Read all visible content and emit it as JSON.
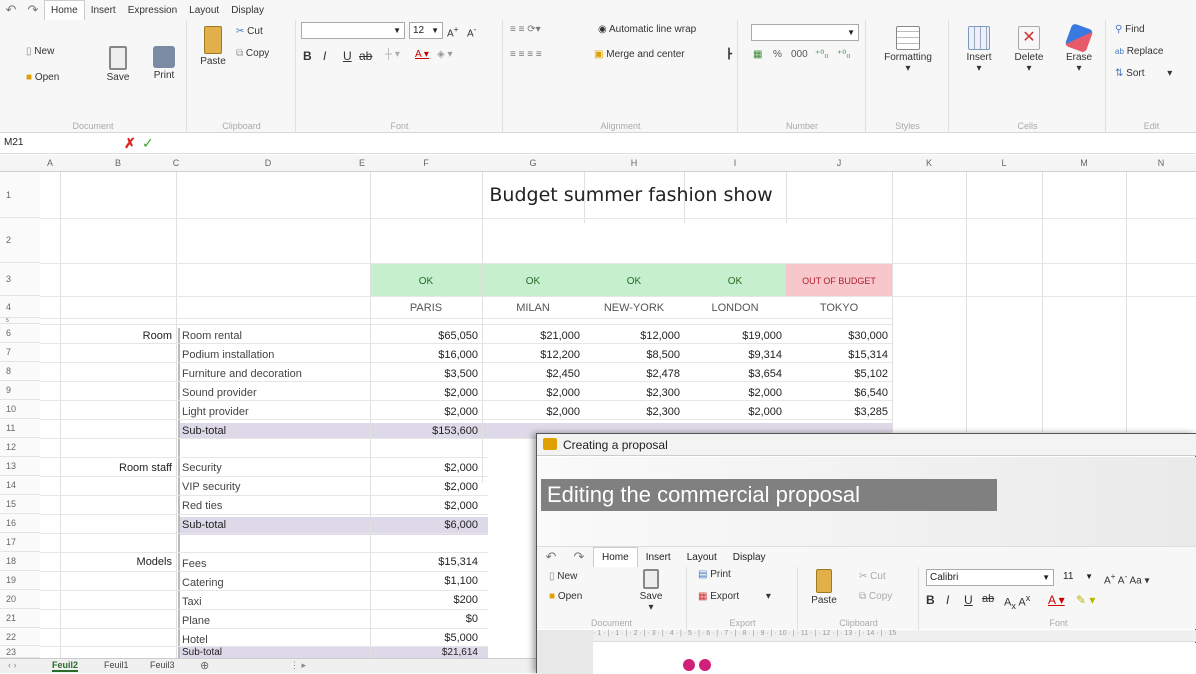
{
  "menu": {
    "tabs": [
      "Home",
      "Insert",
      "Expression",
      "Layout",
      "Display"
    ]
  },
  "ribbon": {
    "new": "New",
    "open": "Open",
    "save": "Save",
    "print": "Print",
    "paste": "Paste",
    "cut": "Cut",
    "copy": "Copy",
    "font_size": "12",
    "auto_wrap": "Automatic line wrap",
    "merge": "Merge and center",
    "num_fmt": "000",
    "formatting": "Formatting",
    "insert": "Insert",
    "delete": "Delete",
    "erase": "Erase",
    "find": "Find",
    "replace": "Replace",
    "sort": "Sort",
    "groups": [
      "Document",
      "Clipboard",
      "Font",
      "Alignment",
      "Number",
      "Styles",
      "Cells",
      "Edit"
    ]
  },
  "formula_bar": {
    "cell_ref": "M21"
  },
  "columns": [
    "A",
    "B",
    "C",
    "D",
    "E",
    "F",
    "G",
    "H",
    "I",
    "J",
    "K",
    "L",
    "M",
    "N"
  ],
  "rows": [
    "1",
    "2",
    "3",
    "4",
    "5",
    "6",
    "7",
    "8",
    "9",
    "10",
    "11",
    "12",
    "13",
    "14",
    "15",
    "16",
    "17",
    "18",
    "19",
    "20",
    "21",
    "22",
    "23"
  ],
  "sheet": {
    "title": "Budget summer fashion show",
    "status": [
      "OK",
      "OK",
      "OK",
      "OK",
      "OUT OF BUDGET"
    ],
    "cities": [
      "PARIS",
      "MILAN",
      "NEW-YORK",
      "LONDON",
      "TOKYO"
    ],
    "room_label": "Room",
    "room_items": [
      {
        "name": "Room rental",
        "v": [
          "$65,050",
          "$21,000",
          "$12,000",
          "$19,000",
          "$30,000"
        ]
      },
      {
        "name": "Podium installation",
        "v": [
          "$16,000",
          "$12,200",
          "$8,500",
          "$9,314",
          "$15,314"
        ]
      },
      {
        "name": "Furniture and decoration",
        "v": [
          "$3,500",
          "$2,450",
          "$2,478",
          "$3,654",
          "$5,102"
        ]
      },
      {
        "name": "Sound provider",
        "v": [
          "$2,000",
          "$2,000",
          "$2,300",
          "$2,000",
          "$6,540"
        ]
      },
      {
        "name": "Light provider",
        "v": [
          "$2,000",
          "$2,000",
          "$2,300",
          "$2,000",
          "$3,285"
        ]
      }
    ],
    "room_subtotal": {
      "name": "Sub-total",
      "v": "$153,600"
    },
    "staff_label": "Room staff",
    "staff_items": [
      {
        "name": "Security",
        "v": "$2,000"
      },
      {
        "name": "VIP security",
        "v": "$2,000"
      },
      {
        "name": "Red ties",
        "v": "$2,000"
      }
    ],
    "staff_subtotal": {
      "name": "Sub-total",
      "v": "$6,000"
    },
    "models_label": "Models",
    "models_items": [
      {
        "name": "Fees",
        "v": "$15,314"
      },
      {
        "name": "Catering",
        "v": "$1,100"
      },
      {
        "name": "Taxi",
        "v": "$200"
      },
      {
        "name": "Plane",
        "v": "$0"
      },
      {
        "name": "Hotel",
        "v": "$5,000"
      }
    ],
    "models_subtotal": {
      "name": "Sub-total",
      "v": "$21,614"
    }
  },
  "sheet_tabs": [
    "Feuil2",
    "Feuil1",
    "Feuil3"
  ],
  "dialog": {
    "title": "Creating a proposal",
    "heading": "Editing the commercial proposal",
    "tabs": [
      "Home",
      "Insert",
      "Layout",
      "Display"
    ],
    "new": "New",
    "open": "Open",
    "save": "Save",
    "print": "Print",
    "export": "Export",
    "paste": "Paste",
    "cut": "Cut",
    "copy": "Copy",
    "font": "Calibri",
    "size": "11",
    "groups": [
      "Document",
      "Export",
      "Clipboard",
      "Font"
    ],
    "ruler": "· 1 · | · 1 · | · 2 · | · 3 · | · 4 · | · 5 · | · 6 · | · 7 · | · 8 · | · 9 · | · 10 · | · 11 · | · 12 · | · 13 · | · 14 · | · 15"
  },
  "colors": {
    "ok": "#c6efce",
    "out": "#f8c7cc",
    "subtotal": "#ded9e8",
    "accent": "#f0a030"
  }
}
